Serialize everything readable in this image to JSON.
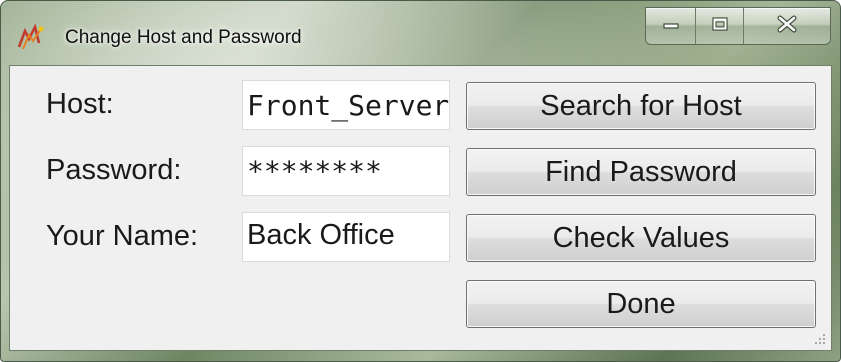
{
  "window": {
    "title": "Change Host and Password"
  },
  "form": {
    "host_label": "Host:",
    "host_value": "Front_Server",
    "password_label": "Password:",
    "password_value": "********",
    "name_label": "Your Name:",
    "name_value": "Back Office"
  },
  "buttons": {
    "search_host": "Search for Host",
    "find_password": "Find Password",
    "check_values": "Check Values",
    "done": "Done"
  },
  "icons": {
    "app": "app-icon",
    "minimize": "minimize-icon",
    "maximize": "maximize-icon",
    "close": "close-icon",
    "resize": "resize-grip-icon"
  }
}
